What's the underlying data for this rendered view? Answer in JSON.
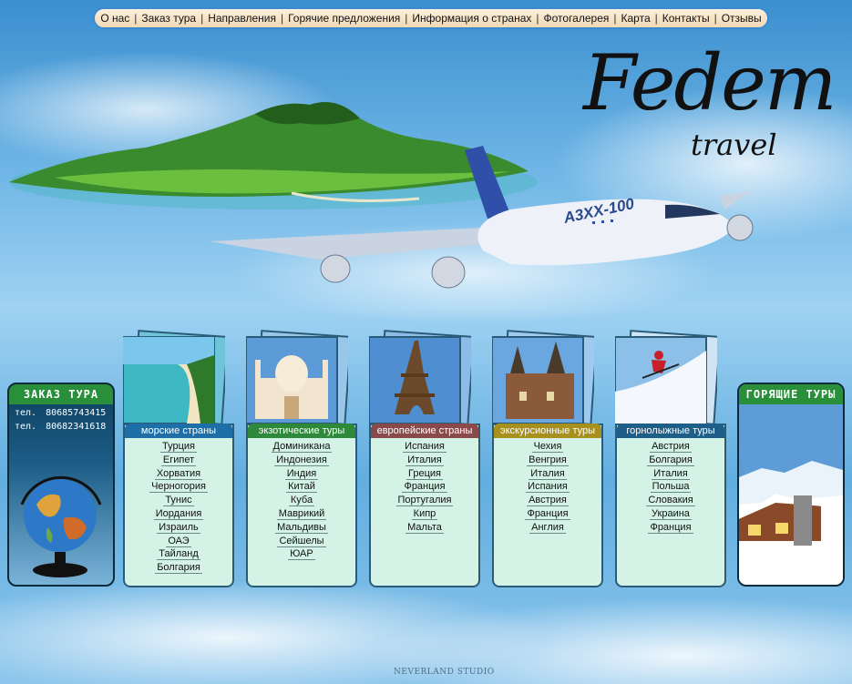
{
  "nav": {
    "items": [
      {
        "label": "О нас"
      },
      {
        "label": "Заказ тура"
      },
      {
        "label": "Направления"
      },
      {
        "label": "Горячие предложения"
      },
      {
        "label": "Информация о странах"
      },
      {
        "label": "Фотогалерея"
      },
      {
        "label": "Карта"
      },
      {
        "label": "Контакты"
      },
      {
        "label": "Отзывы"
      }
    ],
    "separator": "|"
  },
  "logo": {
    "main": "Fedem",
    "sub": "travel"
  },
  "plane_label": "A3XX-100",
  "order_box": {
    "title": "ЗАКАЗ ТУРА",
    "phones": [
      {
        "label": "тел.",
        "number": "80685743415"
      },
      {
        "label": "тел.",
        "number": "80682341618"
      }
    ]
  },
  "hot_box": {
    "title": "ГОРЯЩИЕ ТУРЫ"
  },
  "categories": [
    {
      "title": "морские страны",
      "color": "#1e6fa8",
      "items": [
        "Турция",
        "Египет",
        "Хорватия",
        "Черногория",
        "Тунис",
        "Иордания",
        "Израиль",
        "ОАЭ",
        "Тайланд",
        "Болгария"
      ]
    },
    {
      "title": "экзотические туры",
      "color": "#2e8a3a",
      "items": [
        "Доминикана",
        "Индонезия",
        "Индия",
        "Китай",
        "Куба",
        "Маврикий",
        "Мальдивы",
        "Сейшелы",
        "ЮАР"
      ]
    },
    {
      "title": "европейские страны",
      "color": "#8a4a4a",
      "items": [
        "Испания",
        "Италия",
        "Греция",
        "Франция",
        "Португалия",
        "Кипр",
        "Мальта"
      ]
    },
    {
      "title": "экскурсионные туры",
      "color": "#a8901e",
      "items": [
        "Чехия",
        "Венгрия",
        "Италия",
        "Испания",
        "Австрия",
        "Франция",
        "Англия"
      ]
    },
    {
      "title": "горнолыжные туры",
      "color": "#1e5f8a",
      "items": [
        "Австрия",
        "Болгария",
        "Италия",
        "Польша",
        "Словакия",
        "Украина",
        "Франция"
      ]
    }
  ],
  "footer": {
    "credit": "NEVERLAND STUDIO"
  }
}
